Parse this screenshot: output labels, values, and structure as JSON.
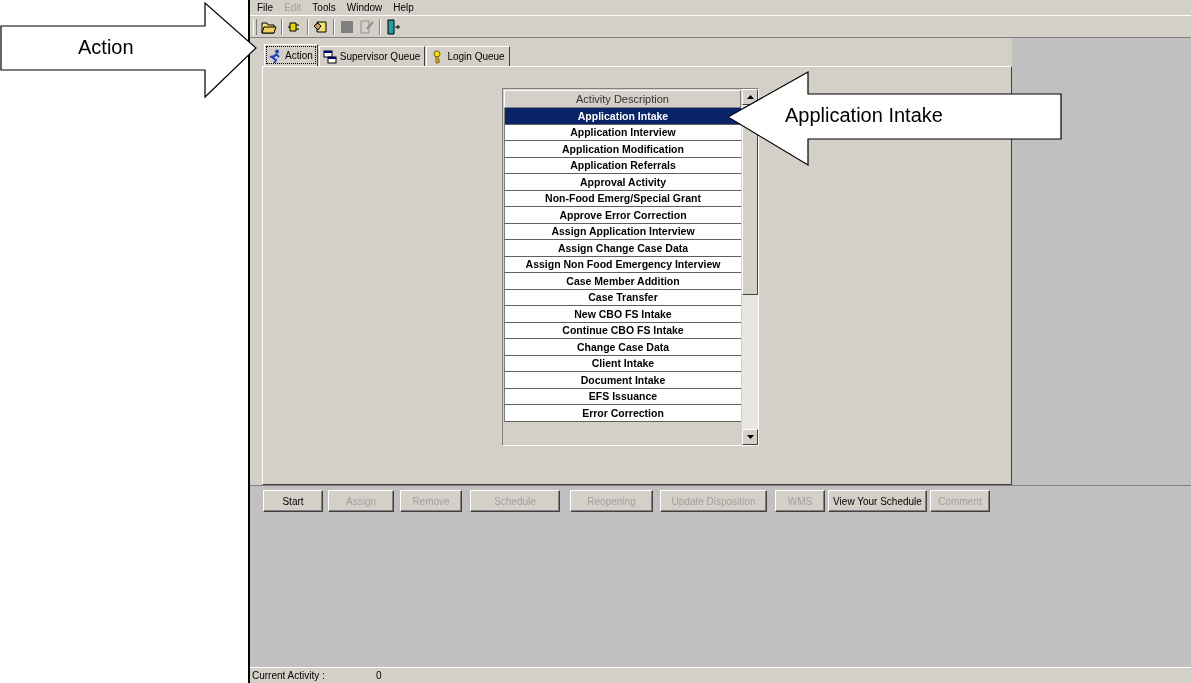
{
  "menu": [
    {
      "label": "File",
      "disabled": false
    },
    {
      "label": "Edit",
      "disabled": true
    },
    {
      "label": "Tools",
      "disabled": false
    },
    {
      "label": "Window",
      "disabled": false
    },
    {
      "label": "Help",
      "disabled": false
    }
  ],
  "toolbar": [
    {
      "kind": "folder",
      "disabled": false
    },
    {
      "kind": "plug",
      "disabled": false
    },
    {
      "kind": "hand",
      "disabled": false
    },
    {
      "kind": "square",
      "disabled": true
    },
    {
      "kind": "edit",
      "disabled": true
    },
    {
      "kind": "exit",
      "disabled": false
    }
  ],
  "tabs": [
    {
      "label": "Action",
      "kind": "runner",
      "selected": true
    },
    {
      "label": "Supervisor Queue",
      "kind": "windows",
      "selected": false
    },
    {
      "label": "Login Queue",
      "kind": "key",
      "selected": false
    }
  ],
  "list": {
    "header": "Activity Description",
    "rows": [
      {
        "label": "Application Intake",
        "selected": true
      },
      {
        "label": "Application Interview",
        "selected": false
      },
      {
        "label": "Application Modification",
        "selected": false
      },
      {
        "label": "Application Referrals",
        "selected": false
      },
      {
        "label": "Approval Activity",
        "selected": false
      },
      {
        "label": "Non-Food Emerg/Special Grant",
        "selected": false
      },
      {
        "label": "Approve Error Correction",
        "selected": false
      },
      {
        "label": "Assign Application Interview",
        "selected": false
      },
      {
        "label": "Assign Change Case Data",
        "selected": false
      },
      {
        "label": "Assign Non Food Emergency Interview",
        "selected": false
      },
      {
        "label": "Case Member Addition",
        "selected": false
      },
      {
        "label": "Case Transfer",
        "selected": false
      },
      {
        "label": "New CBO FS Intake",
        "selected": false
      },
      {
        "label": "Continue CBO FS Intake",
        "selected": false
      },
      {
        "label": "Change Case Data",
        "selected": false
      },
      {
        "label": "Client Intake",
        "selected": false
      },
      {
        "label": "Document Intake",
        "selected": false
      },
      {
        "label": "EFS Issuance",
        "selected": false
      },
      {
        "label": "Error Correction",
        "selected": false
      }
    ]
  },
  "buttons": [
    {
      "label": "Start",
      "disabled": false
    },
    {
      "label": "Assign",
      "disabled": true
    },
    {
      "label": "Remove",
      "disabled": true
    },
    {
      "label": "Schedule",
      "disabled": true
    },
    {
      "label": "Reopening",
      "disabled": true
    },
    {
      "label": "Update Disposition",
      "disabled": true
    },
    {
      "label": "WMS",
      "disabled": true
    },
    {
      "label": "View Your Schedule",
      "disabled": false
    },
    {
      "label": "Comment",
      "disabled": true
    }
  ],
  "status_bar": {
    "label": "Current Activity :",
    "value": "0"
  },
  "callouts": [
    {
      "text": "Action",
      "kind": "pointright"
    },
    {
      "text": "Application Intake",
      "kind": "pointleft"
    }
  ]
}
